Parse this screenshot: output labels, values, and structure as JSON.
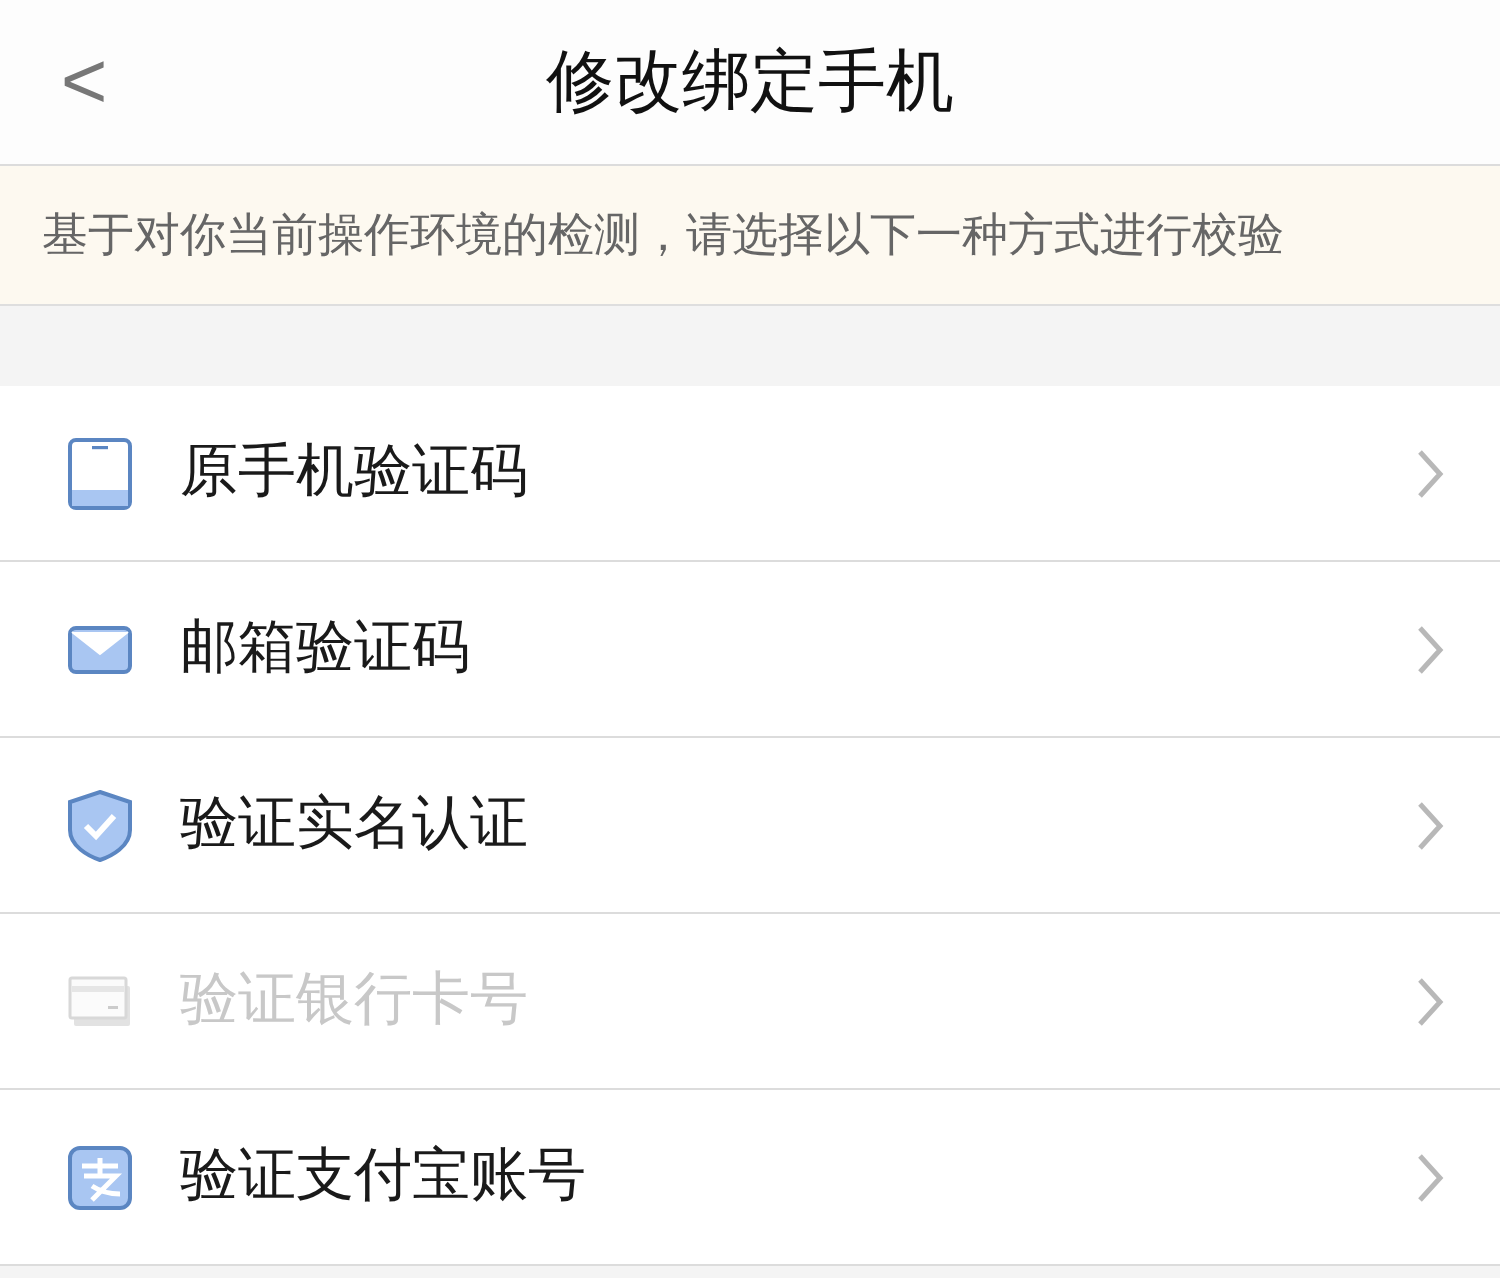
{
  "header": {
    "back": "<",
    "title": "修改绑定手机"
  },
  "notice": "基于对你当前操作环境的检测，请选择以下一种方式进行校验",
  "options": [
    {
      "kind": "phone",
      "label": "原手机验证码",
      "disabled": false
    },
    {
      "kind": "mail",
      "label": "邮箱验证码",
      "disabled": false
    },
    {
      "kind": "shield",
      "label": "验证实名认证",
      "disabled": false
    },
    {
      "kind": "card",
      "label": "验证银行卡号",
      "disabled": true
    },
    {
      "kind": "alipay",
      "label": "验证支付宝账号",
      "disabled": false
    }
  ]
}
